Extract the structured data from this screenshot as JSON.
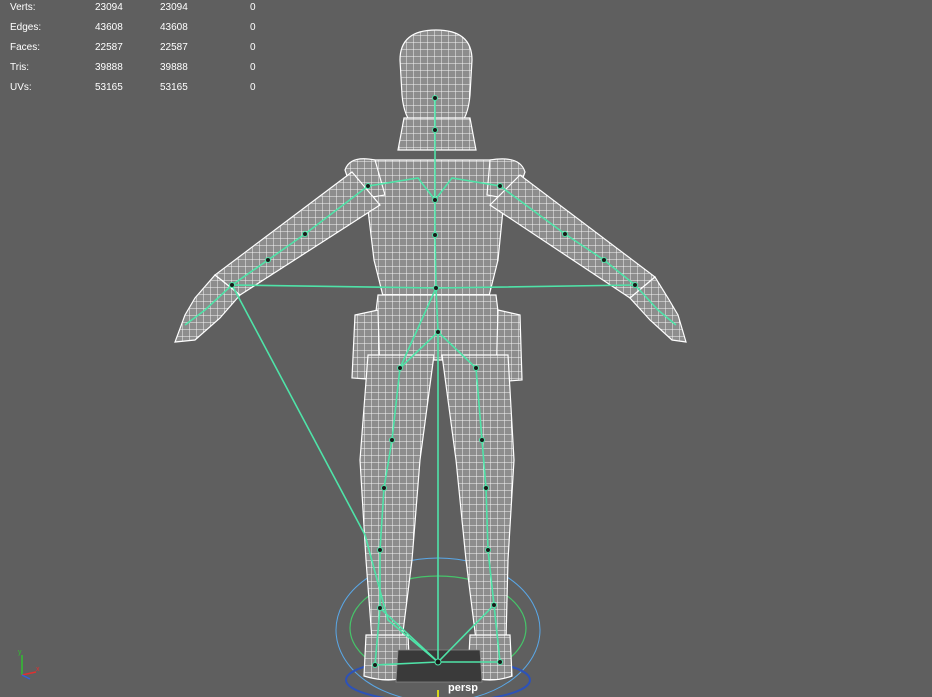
{
  "hud": {
    "rows": [
      {
        "label": "Verts:",
        "values": [
          "23094",
          "23094",
          "0"
        ]
      },
      {
        "label": "Edges:",
        "values": [
          "43608",
          "43608",
          "0"
        ]
      },
      {
        "label": "Faces:",
        "values": [
          "22587",
          "22587",
          "0"
        ]
      },
      {
        "label": "Tris:",
        "values": [
          "39888",
          "39888",
          "0"
        ]
      },
      {
        "label": "UVs:",
        "values": [
          "53165",
          "53165",
          "0"
        ]
      }
    ]
  },
  "viewport": {
    "camera_label": "persp",
    "background": "#5f5f5f",
    "colors": {
      "wireframe": "#f2f2f2",
      "skeleton": "#4fe3a8",
      "grid_ring_outer": "#5aa8e8",
      "grid_ring_inner": "#46c46a",
      "axis_y": "#ffff00"
    }
  },
  "axis_gizmo": {
    "icon": "view-axis-icon",
    "x_color": "#e03030",
    "y_color": "#30c030",
    "z_color": "#3060e0"
  }
}
